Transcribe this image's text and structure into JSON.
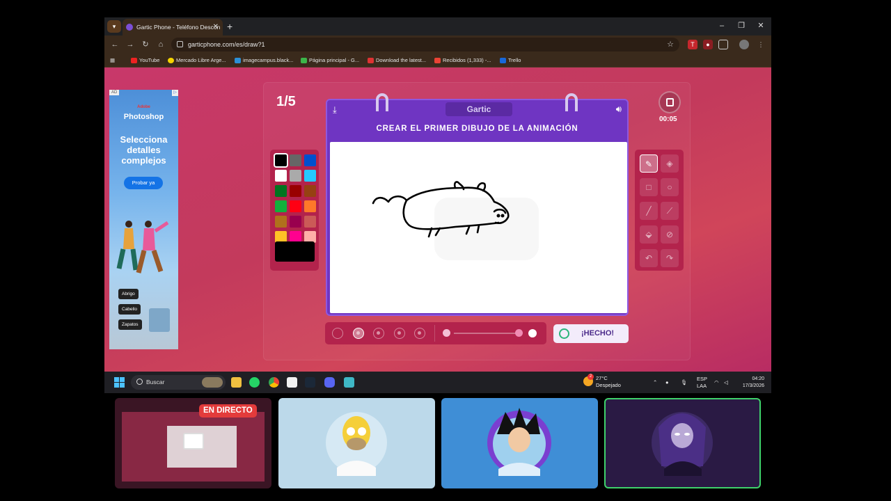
{
  "browser": {
    "tab_title": "Gartic Phone - Teléfono Descon",
    "url": "garticphone.com/es/draw?1",
    "bookmarks": [
      "YouTube",
      "Mercado Libre Arge...",
      "imagecampus.black...",
      "Página principal - G...",
      "Download the latest...",
      "Recibidos (1,333) -...",
      "Trello"
    ]
  },
  "ad": {
    "tag": "AD",
    "brand": "Adobe",
    "product": "Photoshop",
    "headline": "Selecciona detalles complejos",
    "cta": "Probar ya",
    "chips": [
      "Abrigo",
      "Cabello",
      "Zapatos"
    ]
  },
  "game": {
    "round": "1/5",
    "timer": "00:05",
    "logo": "Gartic",
    "instruction": "CREAR EL PRIMER DIBUJO DE LA ANIMACIÓN",
    "done_label": "¡HECHO!",
    "palette": [
      "#000000",
      "#666666",
      "#0050cd",
      "#ffffff",
      "#aaaaaa",
      "#26c9ff",
      "#017420",
      "#990000",
      "#964112",
      "#11b03c",
      "#ff0013",
      "#ff7829",
      "#b0701c",
      "#99004e",
      "#cb5a57",
      "#ffc126",
      "#ff008f",
      "#feafa8"
    ],
    "selected_color": "#000000",
    "tools": [
      "pencil-icon",
      "eraser-icon",
      "rectangle-icon",
      "ellipse-icon",
      "line-icon",
      "eyedropper-icon",
      "fill-icon",
      "clear-icon",
      "undo-icon",
      "redo-icon"
    ],
    "brush_sizes": 5,
    "selected_brush": 2,
    "opacity": 1
  },
  "taskbar": {
    "search": "Buscar",
    "temp": "27°C",
    "weather": "Despejado",
    "weather_badge": "2",
    "lang1": "ESP",
    "lang2": "LAA",
    "time": "04:20",
    "date": "17/3/2026"
  },
  "call": {
    "live_label": "EN DIRECTO"
  }
}
